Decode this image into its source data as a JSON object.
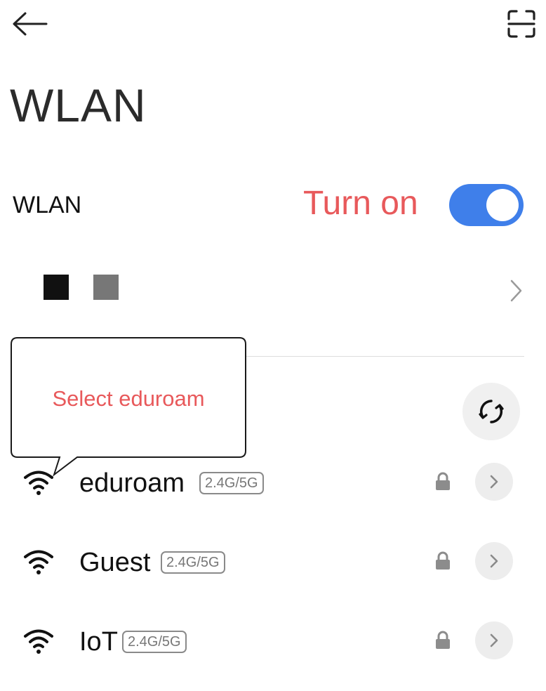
{
  "header": {
    "back_icon": "arrow-left-icon",
    "scan_icon": "scan-icon"
  },
  "page": {
    "title": "WLAN"
  },
  "wlan_toggle": {
    "label": "WLAN",
    "hint": "Turn on",
    "state": "on",
    "accent_color": "#3f7fea",
    "hint_color": "#e8595b"
  },
  "tooltip": {
    "text": "Select eduroam"
  },
  "networks": [
    {
      "name": "eduroam",
      "band": "2.4G/5G",
      "secured": true,
      "signal_icon": "wifi-icon"
    },
    {
      "name": "Guest",
      "band": "2.4G/5G",
      "secured": true,
      "signal_icon": "wifi-icon"
    },
    {
      "name": "IoT",
      "band": "2.4G/5G",
      "secured": true,
      "signal_icon": "wifi-icon"
    }
  ]
}
